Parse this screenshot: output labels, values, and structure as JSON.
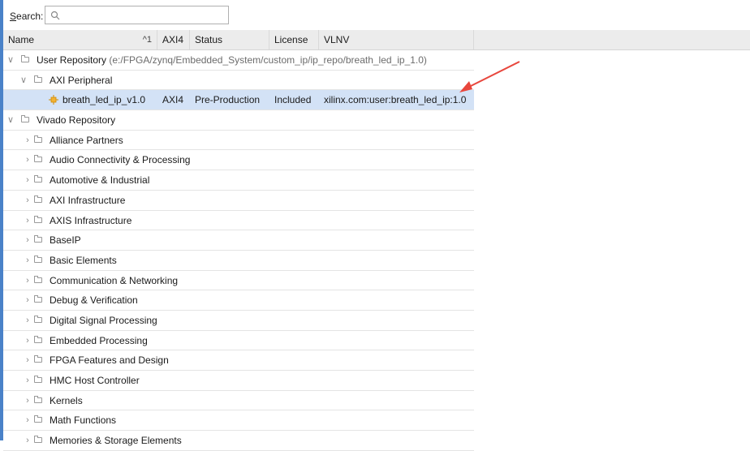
{
  "search": {
    "label_underlined": "S",
    "label_rest": "earch:",
    "value": ""
  },
  "columns": {
    "name": "Name",
    "sort": "^1",
    "axi4": "AXI4",
    "status": "Status",
    "license": "License",
    "vlnv": "VLNV"
  },
  "user_repo": {
    "name": "User Repository",
    "path": "(e:/FPGA/zynq/Embedded_System/custom_ip/ip_repo/breath_led_ip_1.0)"
  },
  "axi_peripheral": {
    "name": "AXI Peripheral"
  },
  "ip_row": {
    "name": "breath_led_ip_v1.0",
    "axi4": "AXI4",
    "status": "Pre-Production",
    "license": "Included",
    "vlnv": "xilinx.com:user:breath_led_ip:1.0"
  },
  "vivado_repo": {
    "name": "Vivado Repository"
  },
  "categories": [
    "Alliance Partners",
    "Audio Connectivity & Processing",
    "Automotive & Industrial",
    "AXI Infrastructure",
    "AXIS Infrastructure",
    "BaseIP",
    "Basic Elements",
    "Communication & Networking",
    "Debug & Verification",
    "Digital Signal Processing",
    "Embedded Processing",
    "FPGA Features and Design",
    "HMC Host Controller",
    "Kernels",
    "Math Functions",
    "Memories & Storage Elements"
  ],
  "colors": {
    "selected_row": "#d3e2f6",
    "annotation_arrow": "#e8463c",
    "left_accent": "#4a82c8"
  }
}
